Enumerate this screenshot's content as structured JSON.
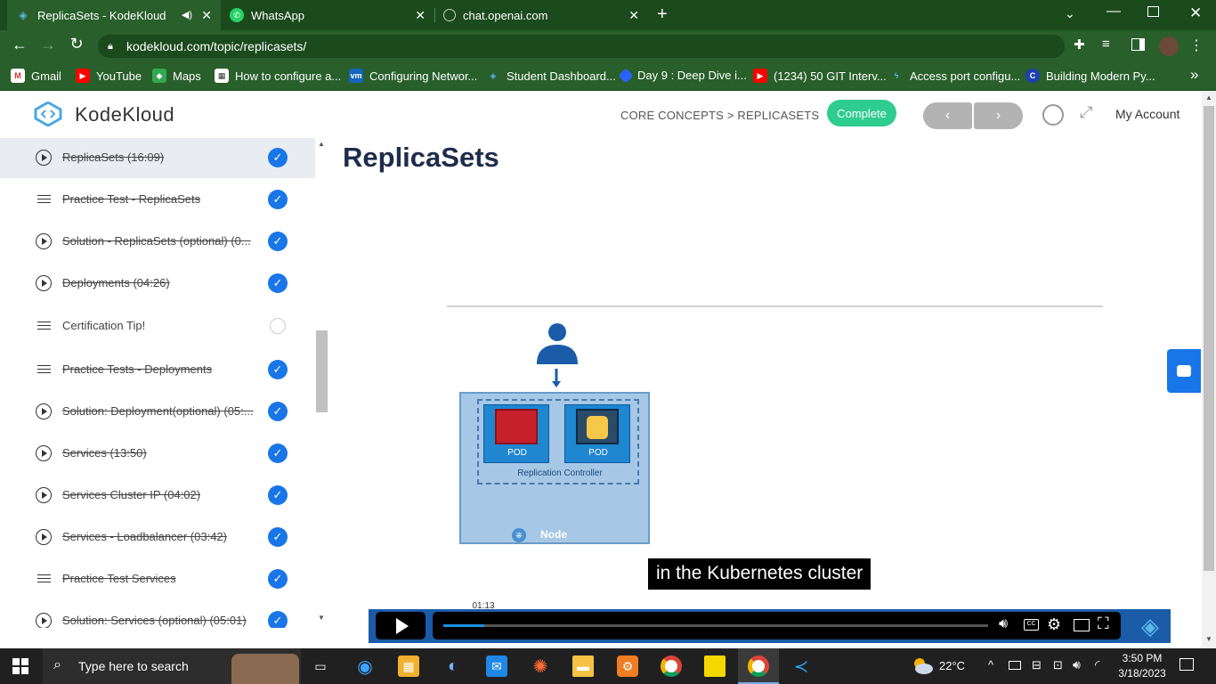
{
  "browser": {
    "tabs": [
      {
        "title": "ReplicaSets - KodeKloud",
        "active": true
      },
      {
        "title": "WhatsApp",
        "active": false
      },
      {
        "title": "chat.openai.com",
        "active": false
      }
    ],
    "url": "kodekloud.com/topic/replicasets/",
    "bookmarks": [
      "Gmail",
      "YouTube",
      "Maps",
      "How to configure a...",
      "Configuring Networ...",
      "Student Dashboard...",
      "Day 9 : Deep Dive i...",
      "(1234) 50 GIT Interv...",
      "Access port configu...",
      "Building Modern Py..."
    ]
  },
  "site": {
    "logo_text": "KodeKloud",
    "breadcrumb": "CORE CONCEPTS > REPLICASETS",
    "complete_label": "Complete",
    "prev_label": "‹",
    "next_label": "›",
    "account_label": "My Account",
    "page_title": "ReplicaSets"
  },
  "lessons": [
    {
      "title": "ReplicaSets (16:09)",
      "type": "video",
      "done": true
    },
    {
      "title": "Practice Test - ReplicaSets",
      "type": "doc",
      "done": true
    },
    {
      "title": "Solution - ReplicaSets (optional) (0...",
      "type": "video",
      "done": true
    },
    {
      "title": "Deployments (04:26)",
      "type": "video",
      "done": true
    },
    {
      "title": "Certification Tip!",
      "type": "doc",
      "done": false
    },
    {
      "title": "Practice Tests - Deployments",
      "type": "doc",
      "done": true
    },
    {
      "title": "Solution: Deployment(optional) (05:...",
      "type": "video",
      "done": true
    },
    {
      "title": "Services (13:50)",
      "type": "video",
      "done": true
    },
    {
      "title": "Services Cluster IP (04:02)",
      "type": "video",
      "done": true
    },
    {
      "title": "Services - Loadbalancer (03:42)",
      "type": "video",
      "done": true
    },
    {
      "title": "Practice Test Services",
      "type": "doc",
      "done": true
    },
    {
      "title": "Solution: Services (optional) (05:01)",
      "type": "video",
      "done": true
    }
  ],
  "diagram": {
    "pod1_label": "POD",
    "pod2_label": "POD",
    "controller_label": "Replication Controller",
    "node_label": "Node"
  },
  "video": {
    "caption": "in the Kubernetes cluster",
    "time_tooltip": "01:13",
    "progress": 0.075
  },
  "taskbar": {
    "search_placeholder": "Type here to search",
    "weather": "22°C",
    "time": "3:50 PM",
    "date": "3/18/2023"
  },
  "colors": {
    "chrome_dark": "#1b4a1d",
    "chrome": "#285f2a",
    "accent_blue": "#1976e8",
    "complete_green": "#2ecc8f",
    "title_navy": "#1e2d4a"
  }
}
